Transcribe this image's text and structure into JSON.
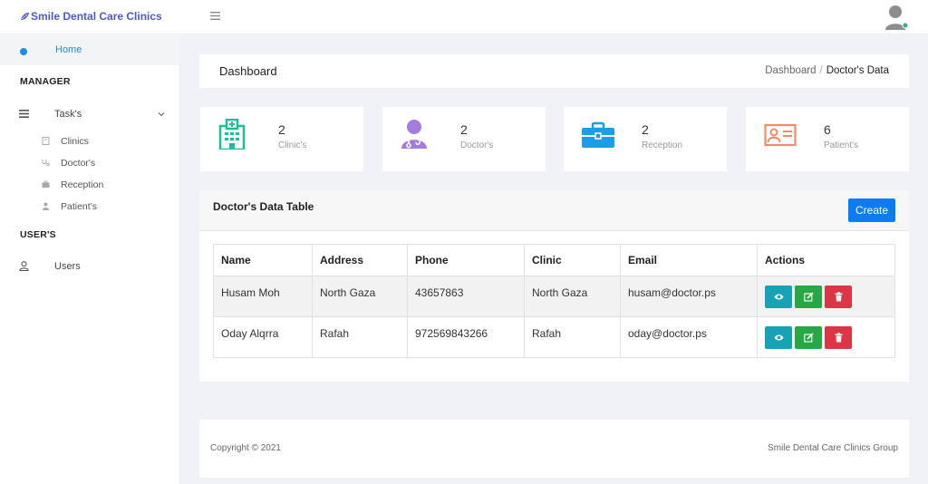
{
  "topbar": {
    "brand": "Smile Dental Care Clinics"
  },
  "sidebar": {
    "home": "Home",
    "manager_heading": "MANAGER",
    "tasks": "Task's",
    "sub_items": [
      "Clinics",
      "Doctor's",
      "Reception",
      "Patient's"
    ],
    "users_heading": "USER'S",
    "users": "Users"
  },
  "header": {
    "title": "Dashboard",
    "breadcrumb": {
      "home": "Dashboard",
      "sep": "/",
      "current": "Doctor's Data"
    }
  },
  "stats": [
    {
      "value": "2",
      "label": "Clinic's",
      "icon": "hospital-icon",
      "color": "#1bbf9a"
    },
    {
      "value": "2",
      "label": "Doctor's",
      "icon": "doctor-icon",
      "color": "#a57be0"
    },
    {
      "value": "2",
      "label": "Reception",
      "icon": "briefcase-icon",
      "color": "#1b9de8"
    },
    {
      "value": "6",
      "label": "Patient's",
      "icon": "id-card-icon",
      "color": "#ef8b6b"
    }
  ],
  "panel": {
    "title": "Doctor's Data Table",
    "create": "Create"
  },
  "table": {
    "headers": [
      "Name",
      "Address",
      "Phone",
      "Clinic",
      "Email",
      "Actions"
    ],
    "rows": [
      [
        "Husam Moh",
        "North Gaza",
        "43657863",
        "North Gaza",
        "husam@doctor.ps"
      ],
      [
        "Oday Alqrra",
        "Rafah",
        "972569843266",
        "Rafah",
        "oday@doctor.ps"
      ]
    ]
  },
  "footer": {
    "copyright": "Copyright © 2021",
    "group": "Smile Dental Care Clinics Group"
  },
  "colors": {
    "accent": "#1f8ee6",
    "brand": "#4e58d6",
    "create": "#0d7cf2",
    "view": "#17a2b8",
    "edit": "#28a745",
    "delete": "#dc3545"
  }
}
